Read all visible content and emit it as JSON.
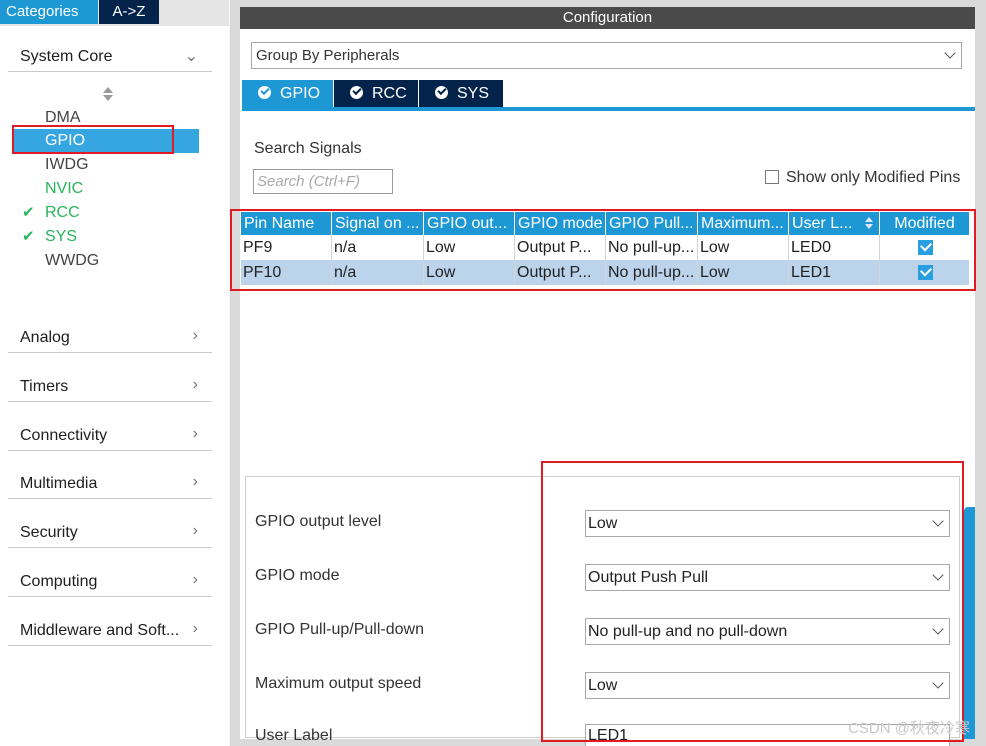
{
  "left_tabs": {
    "categories": "Categories",
    "az": "A->Z"
  },
  "system_core": {
    "label": "System Core",
    "items": [
      {
        "label": "DMA",
        "state": "normal"
      },
      {
        "label": "GPIO",
        "state": "selected"
      },
      {
        "label": "IWDG",
        "state": "normal"
      },
      {
        "label": "NVIC",
        "state": "green"
      },
      {
        "label": "RCC",
        "state": "checked"
      },
      {
        "label": "SYS",
        "state": "checked"
      },
      {
        "label": "WWDG",
        "state": "normal"
      }
    ]
  },
  "categories": [
    {
      "label": "Analog"
    },
    {
      "label": "Timers"
    },
    {
      "label": "Connectivity"
    },
    {
      "label": "Multimedia"
    },
    {
      "label": "Security"
    },
    {
      "label": "Computing"
    },
    {
      "label": "Middleware and Soft..."
    }
  ],
  "config": {
    "title": "Configuration",
    "group_by": "Group By Peripherals",
    "tabs": [
      "GPIO",
      "RCC",
      "SYS"
    ],
    "search_label": "Search Signals",
    "search_placeholder": "Search (Ctrl+F)",
    "show_modified_label": "Show only Modified Pins",
    "table": {
      "headers": [
        "Pin Name",
        "Signal on ...",
        "GPIO out...",
        "GPIO mode",
        "GPIO Pull...",
        "Maximum...",
        "User L...",
        "Modified"
      ],
      "rows": [
        {
          "cells": [
            "PF9",
            "n/a",
            "Low",
            "Output P...",
            "No pull-up...",
            "Low",
            "LED0"
          ],
          "modified": true,
          "selected": false
        },
        {
          "cells": [
            "PF10",
            "n/a",
            "Low",
            "Output P...",
            "No pull-up...",
            "Low",
            "LED1"
          ],
          "modified": true,
          "selected": true
        }
      ]
    },
    "properties": {
      "output_level": {
        "label": "GPIO output level",
        "value": "Low"
      },
      "mode": {
        "label": "GPIO mode",
        "value": "Output Push Pull"
      },
      "pull": {
        "label": "GPIO Pull-up/Pull-down",
        "value": "No pull-up and no pull-down"
      },
      "speed": {
        "label": "Maximum output speed",
        "value": "Low"
      },
      "user_label": {
        "label": "User Label",
        "value": "LED1"
      }
    }
  },
  "watermark": "CSDN @秋夜冷寒",
  "colors": {
    "accent": "#1d98d4",
    "dark_tab": "#03234b",
    "highlight": "#e01b24",
    "ok_green": "#28b45a"
  }
}
